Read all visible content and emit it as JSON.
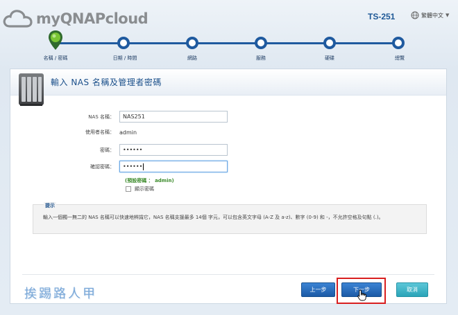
{
  "header": {
    "brand": "myQNAPcloud",
    "device_name": "TS-251",
    "language": "繁體中文",
    "icons": [
      "cloud-logo-icon",
      "globe-icon",
      "chevron-down-icon"
    ]
  },
  "wizard": {
    "current_step": 1,
    "steps": [
      {
        "label": "名稱 / 密碼"
      },
      {
        "label": "日期 / 時間"
      },
      {
        "label": "網路"
      },
      {
        "label": "服務"
      },
      {
        "label": "硬碟"
      },
      {
        "label": "總覽"
      }
    ]
  },
  "panel": {
    "title": "輸入 NAS 名稱及管理者密碼",
    "fields": {
      "nas_name": {
        "label": "NAS 名稱：",
        "value": "NAS251"
      },
      "username": {
        "label": "使用者名稱：",
        "value": "admin"
      },
      "password": {
        "label": "密碼：",
        "value": "••••••"
      },
      "confirm_password": {
        "label": "確認密碼：",
        "value": "••••••"
      }
    },
    "default_password_hint": "(預設密碼 ： admin)",
    "show_password_label": "顯示密碼",
    "show_password_checked": false,
    "tip": {
      "title": "提示",
      "text": "輸入一個獨一無二的 NAS 名稱可以快速地辨識它，NAS 名稱支援最多 14個 字元，可以包含英文字母 (A-Z 及 a-z)、數字 (0-9) 和 -，不允許空格及句點 (.)。"
    }
  },
  "watermark": "挨踢路人甲",
  "buttons": {
    "prev": "上一步",
    "next": "下一步",
    "cancel": "取消"
  },
  "colors": {
    "brand_blue": "#1f5a9f",
    "highlight_red": "#d81e1e",
    "hint_green": "#3b8a2a",
    "cancel_teal": "#2aa4b8"
  }
}
